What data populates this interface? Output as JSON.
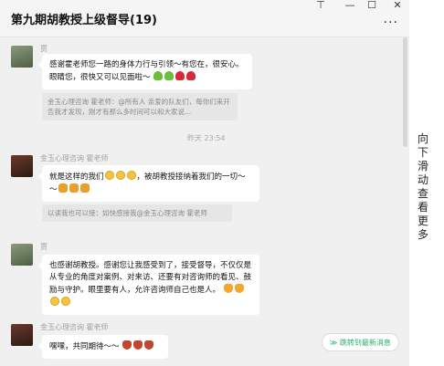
{
  "window": {
    "title": "第九期胡教授上级督导(19)",
    "controls": {
      "pin": "⊤",
      "minimize": "—",
      "maximize": "☐",
      "close": "✕"
    },
    "more": "···"
  },
  "messages": [
    {
      "sender": "贾",
      "text": "感谢霍老师您一路的身体力行与引领～有您在，很安心。眼睛您，很快又可以见面啦～",
      "emojis": [
        "plant",
        "plant",
        "rose",
        "rose"
      ],
      "quote": "金玉心理咨询 霍老师：@所有人 亲爱的队友们，每你们来开告我才发现，刚才有那么多时间可以和大家说..."
    },
    {
      "time": "昨天 23:54"
    },
    {
      "sender": "金玉心理咨询 霍老师",
      "text_before": "就是这样的我们",
      "emojis_mid": [
        "face",
        "face",
        "face"
      ],
      "text_after": "，被胡教授接纳着我们的一切～～",
      "emojis_end": [
        "fist",
        "fist",
        "fist"
      ],
      "quote": "以读我也可以接：如快感接我@金玉心理咨询 霍老师"
    },
    {
      "sender": "贾",
      "text": "也感谢胡教授。感谢您让我感受到了，接受督导，不仅仅是从专业的角度对案例、对来访、还要有对咨询师的看见、鼓励与守护。眼里要有人，允许咨询师自己也是人。",
      "emojis": [
        "pray",
        "pray",
        "face",
        "face"
      ]
    },
    {
      "sender": "金玉心理咨询 霍老师",
      "text": "嘿嘿，共同期待～～",
      "emojis": [
        "cheer",
        "cheer",
        "cheer"
      ]
    }
  ],
  "jump_button": {
    "icon": "≫",
    "label": "跳转到最新消息"
  },
  "side_panel": {
    "label": "向下滑动查看更多"
  },
  "colors": {
    "accent": "#2aae67",
    "background": "#f0f0f0",
    "bubble": "#ffffff"
  }
}
